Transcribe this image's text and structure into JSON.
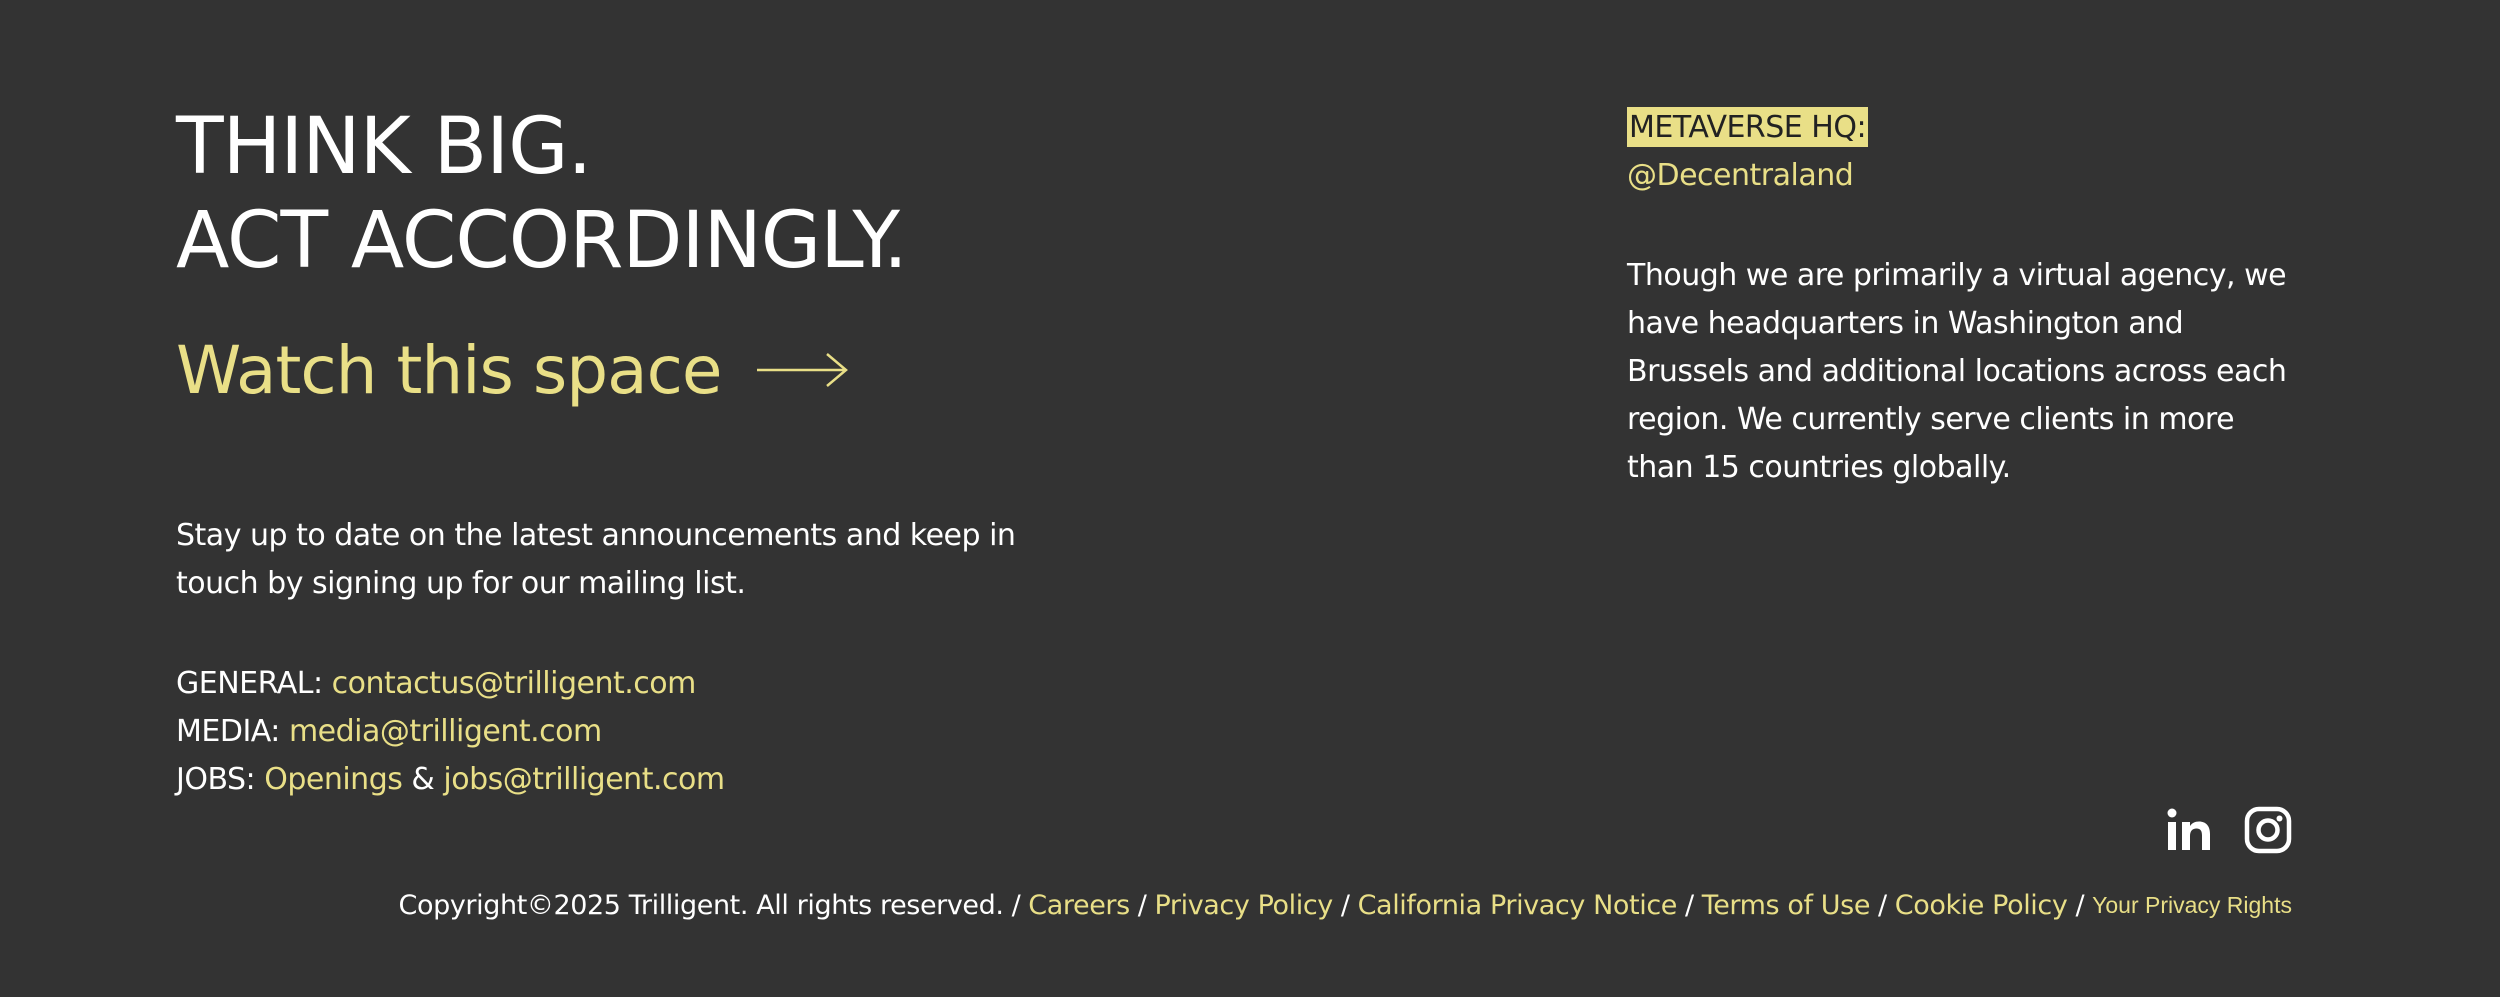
{
  "colors": {
    "background": "#333333",
    "text": "#ffffff",
    "accent": "#e9df87"
  },
  "hero": {
    "line1": "THINK BIG.",
    "line2": "ACT ACCORDINGLY.",
    "cta": "Watch this space",
    "cta_icon": "arrow-right-icon"
  },
  "mailing_text": "Stay up to date on the latest announcements and keep in touch by signing up for our mailing list.",
  "contacts": {
    "general_label": "GENERAL:",
    "general_email": "contactus@trilligent.com",
    "media_label": "MEDIA:",
    "media_email": "media@trilligent.com",
    "jobs_label": "JOBS:",
    "jobs_openings": "Openings",
    "jobs_amp": "&",
    "jobs_email": "jobs@trilligent.com"
  },
  "hq": {
    "label": "METAVERSE HQ:",
    "handle": "@Decentraland",
    "description": "Though we are primarily a virtual agency, we have headquarters in Washington and Brussels and additional locations across each region. We currently serve clients in more than 15 countries globally."
  },
  "social": {
    "linkedin_icon": "linkedin-icon",
    "instagram_icon": "instagram-icon"
  },
  "footer": {
    "copyright": "Copyright©2025 Trilligent. All rights reserved.",
    "separator": "/",
    "links": [
      "Careers",
      "Privacy Policy",
      "California Privacy Notice",
      "Terms of Use",
      "Cookie Policy"
    ],
    "privacy_rights": "Your Privacy Rights"
  }
}
